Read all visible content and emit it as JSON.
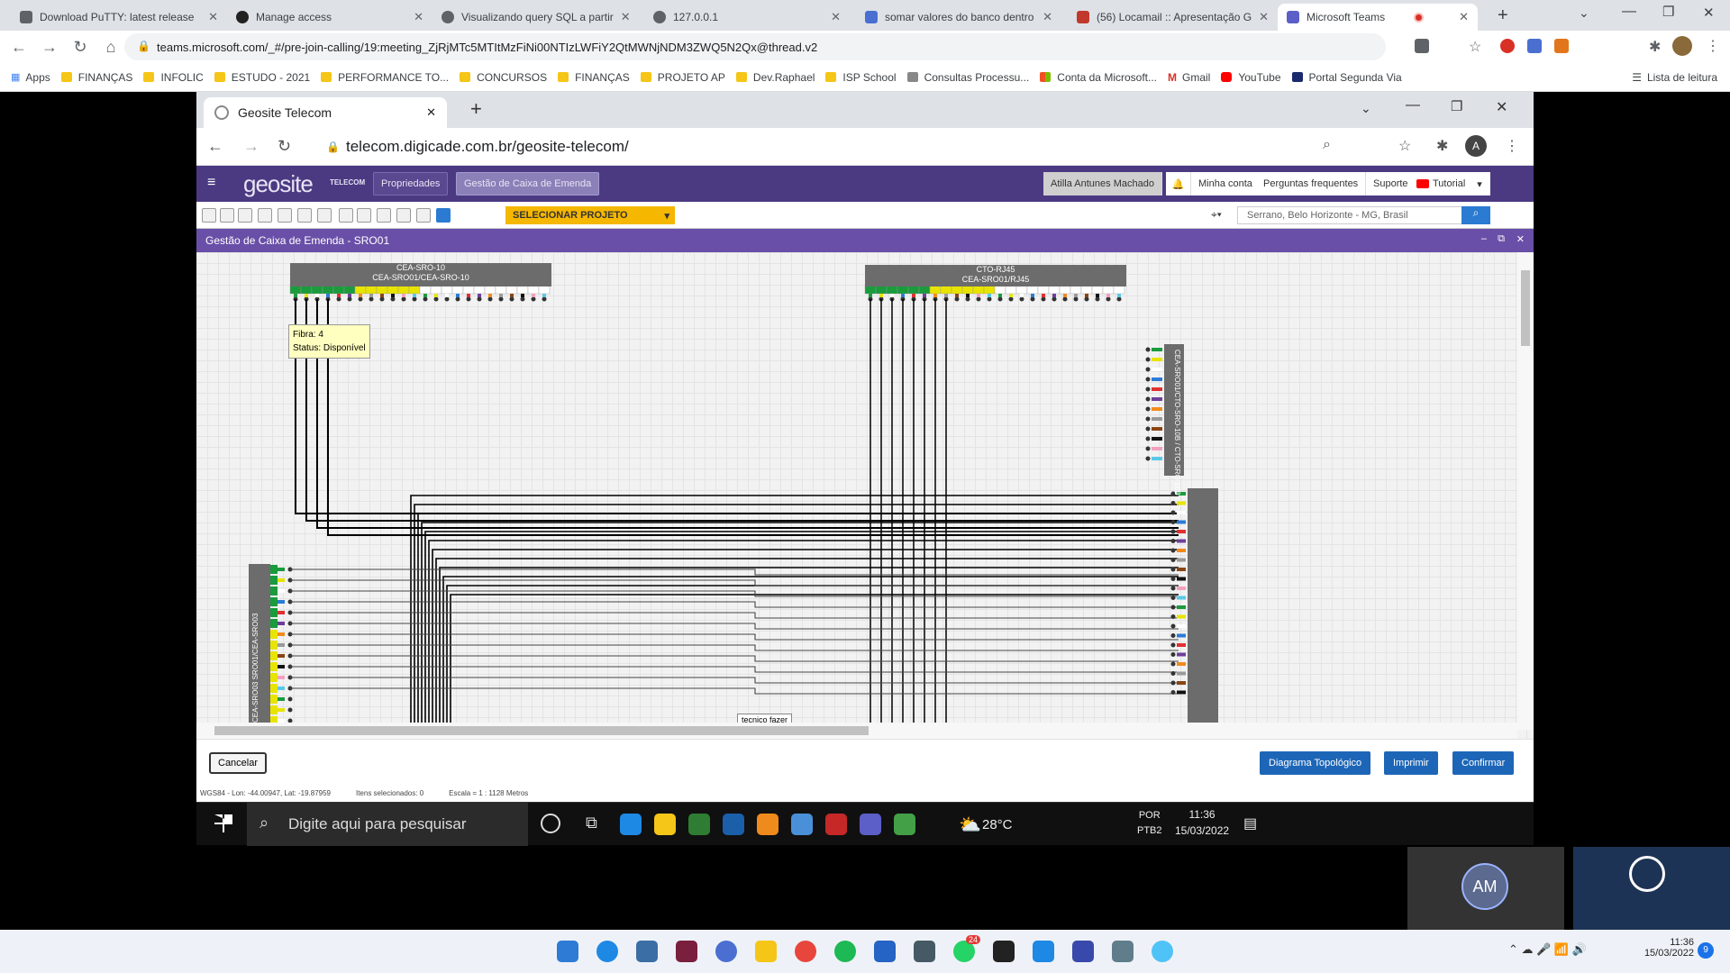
{
  "outer_tabs": [
    {
      "title": "Download PuTTY: latest release"
    },
    {
      "title": "Manage access"
    },
    {
      "title": "Visualizando query SQL a partir"
    },
    {
      "title": "127.0.0.1"
    },
    {
      "title": "somar valores do banco dentro"
    },
    {
      "title": "(56) Locamail :: Apresentação G"
    },
    {
      "title": "Microsoft Teams"
    }
  ],
  "outer_url": "teams.microsoft.com/_#/pre-join-calling/19:meeting_ZjRjMTc5MTItMzFiNi00NTIzLWFiY2QtMWNjNDM3ZWQ5N2Qx@thread.v2",
  "bookmarks": [
    "Apps",
    "FINANÇAS",
    "INFOLIC",
    "ESTUDO - 2021",
    "PERFORMANCE TO...",
    "CONCURSOS",
    "FINANÇAS",
    "PROJETO AP",
    "Dev.Raphael",
    "ISP School",
    "Consultas Processu...",
    "Conta da Microsoft...",
    "Gmail",
    "YouTube",
    "Portal Segunda Via"
  ],
  "reading_list": "Lista de leitura",
  "inner_tab": "Geosite Telecom",
  "inner_url": "telecom.digicade.com.br/geosite-telecom/",
  "app": {
    "logo": "geosite",
    "logo_sub": "TELECOM",
    "btn_properties": "Propriedades",
    "btn_splice": "Gestão de Caixa de Emenda",
    "user": "Atilla Antunes Machado",
    "my_account": "Minha conta",
    "faq": "Perguntas frequentes",
    "support": "Suporte",
    "tutorial": "Tutorial",
    "select_project": "SELECIONAR PROJETO",
    "search_value": "Serrano, Belo Horizonte - MG, Brasil",
    "panel_title": "Gestão de Caixa de Emenda - SRO01"
  },
  "diagram": {
    "box1_line1": "CEA-SRO-10",
    "box1_line2": "CEA-SRO01/CEA-SRO-10",
    "box2_line1": "CTO-RJ45",
    "box2_line2": "CEA-SRO01/RJ45",
    "box3_label": "CEA-SRO01/CTO-SRO-10B",
    "box3_label2": "CTO-SRO-10B",
    "box4_label": "CEA-SRO03",
    "box4_label2": "SRO01/CEA-SRO03",
    "tooltip_fiber": "Fibra: 4",
    "tooltip_status": "Status: Disponível",
    "note": "tecnico fazer",
    "fiber_colors": [
      "#1a9b3c",
      "#e8e400",
      "#ffffff",
      "#2b7bd6",
      "#e23030",
      "#6d3f9a",
      "#f18a1c",
      "#9a9a9a",
      "#8b4513",
      "#111111",
      "#f2a0c0",
      "#5ac8e8"
    ]
  },
  "footer": {
    "cancel": "Cancelar",
    "topology": "Diagrama Topológico",
    "print": "Imprimir",
    "confirm": "Confirmar"
  },
  "status": {
    "coords": "WGS84 - Lon: -44.00947, Lat: -19.87959",
    "selected": "Itens selecionados: 0",
    "scale": "Escala = 1 : 1128 Metros"
  },
  "inner_taskbar": {
    "search": "Digite aqui para pesquisar",
    "temp": "28°C",
    "lang1": "POR",
    "lang2": "PTB2",
    "time": "11:36",
    "date": "15/03/2022"
  },
  "outer_taskbar": {
    "time": "11:36",
    "date": "15/03/2022",
    "notif": "9",
    "whatsapp_badge": "24"
  },
  "avatar_initials": "AM"
}
